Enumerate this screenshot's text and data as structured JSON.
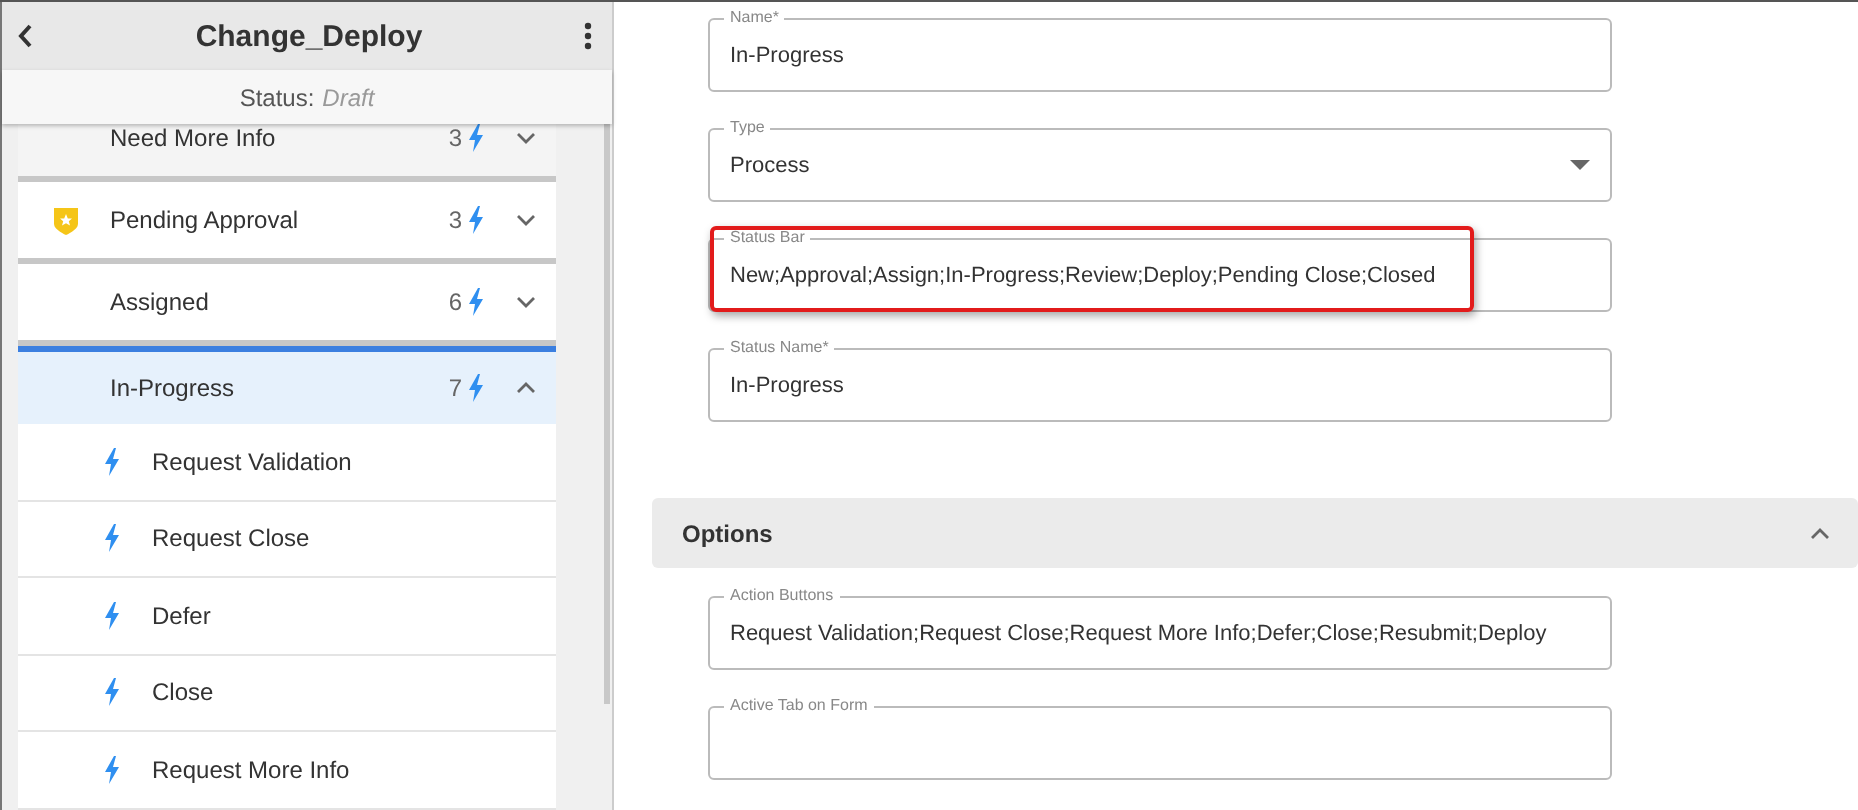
{
  "header": {
    "title": "Change_Deploy",
    "status_label": "Status:",
    "status_value": "Draft"
  },
  "statuses": [
    {
      "name": "Need More Info",
      "count": "3",
      "badge": false,
      "selected": false,
      "expanded": false
    },
    {
      "name": "Pending Approval",
      "count": "3",
      "badge": true,
      "selected": false,
      "expanded": false
    },
    {
      "name": "Assigned",
      "count": "6",
      "badge": false,
      "selected": false,
      "expanded": false
    },
    {
      "name": "In-Progress",
      "count": "7",
      "badge": false,
      "selected": true,
      "expanded": true,
      "actions": [
        "Request Validation",
        "Request Close",
        "Defer",
        "Close",
        "Request More Info"
      ]
    }
  ],
  "fields": [
    {
      "label": "Name*",
      "value": "In-Progress",
      "kind": "text",
      "highlighted": false
    },
    {
      "label": "Type",
      "value": "Process",
      "kind": "select",
      "highlighted": false
    },
    {
      "label": "Status Bar",
      "value": "New;Approval;Assign;In-Progress;Review;Deploy;Pending Close;Closed",
      "kind": "text",
      "highlighted": true
    },
    {
      "label": "Status Name*",
      "value": "In-Progress",
      "kind": "text",
      "highlighted": false
    }
  ],
  "section": {
    "title": "Options",
    "expanded": true,
    "fields": [
      {
        "label": "Action Buttons",
        "value": "Request Validation;Request Close;Request More Info;Defer;Close;Resubmit;Deploy",
        "kind": "text",
        "highlighted": false
      },
      {
        "label": "Active Tab on Form",
        "kind": "text",
        "highlighted": false
      }
    ]
  }
}
